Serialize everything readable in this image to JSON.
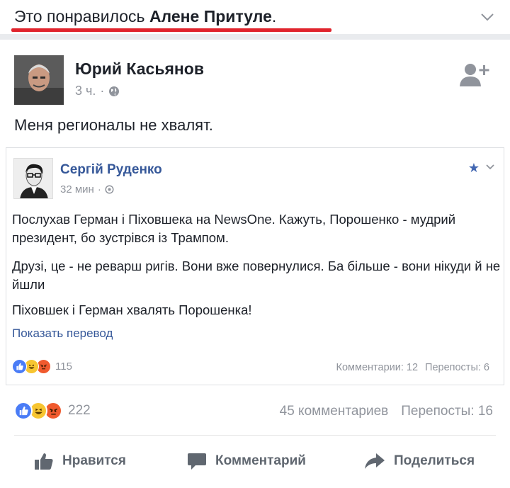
{
  "header": {
    "liked_prefix": "Это понравилось ",
    "liked_name": "Алене Притуле",
    "liked_suffix": "."
  },
  "post": {
    "author": "Юрий Касьянов",
    "time": "3 ч.",
    "separator": "·",
    "text": "Меня регионалы не хвалят."
  },
  "shared": {
    "author": "Сергій Руденко",
    "time": "32 мин",
    "separator": "·",
    "paragraphs": [
      "Послухав Герман і Піховшека на NewsOne. Кажуть, Порошенко - мудрий президент, бо зустрівся із Трампом.",
      "Друзі, це - не реварш ригів. Вони вже повернулися. Ба більше - вони нікуди й не йшли",
      "Піховшек і Герман хвалять Порошенка!"
    ],
    "translate_link": "Показать перевод",
    "reactions_count": "115",
    "comments": "Комментарии: 12",
    "shares": "Перепосты: 6"
  },
  "footer": {
    "reactions_count": "222",
    "comments": "45 комментариев",
    "shares": "Перепосты: 16"
  },
  "actions": {
    "like": "Нравится",
    "comment": "Комментарий",
    "share": "Поделиться"
  },
  "colors": {
    "link_blue": "#365899",
    "accent_red": "#e0242d",
    "muted_grey": "#90949c"
  }
}
